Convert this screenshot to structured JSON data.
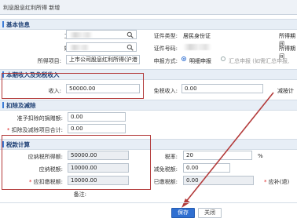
{
  "window": {
    "title": "利息股息红利所得 新增"
  },
  "basic": {
    "section_title": "基本信息",
    "employee_id_label": "工号:",
    "name_label": "姓名:",
    "id_type_label": "证件类型:",
    "id_type_value": "居民身份证",
    "id_number_label": "证件号码:",
    "item_label": "所得项目:",
    "item_value": "上市公司股息红利所得(沪港",
    "declare_label": "申报方式:",
    "declare_opt1": "明细申报",
    "declare_opt2": "汇总申报 (如需汇总申报,",
    "right_cut1": "所得期间",
    "right_cut2": "所得期间"
  },
  "income": {
    "section_title": "本期收入及免税收入",
    "income_label": "收入:",
    "income_value": "50000.00",
    "exempt_label": "免税收入:",
    "exempt_value": "0.00",
    "right_cut": "减按计"
  },
  "deduction": {
    "section_title": "扣除及减除",
    "donation_label": "准予扣除的捐赠额:",
    "donation_value": "0.00",
    "total_label": "扣除及减除项目合计:",
    "total_value": "0.00"
  },
  "tax": {
    "section_title": "税款计算",
    "taxable_label": "应纳税所得额:",
    "taxable_value": "50000.00",
    "rate_label": "税率:",
    "rate_value": "20",
    "rate_unit": "%",
    "payable_label": "应纳税额:",
    "payable_value": "10000.00",
    "reduction_label": "减免税额:",
    "reduction_value": "0.00",
    "withhold_label": "应扣缴税额:",
    "withhold_value": "10000.00",
    "paid_label": "已缴税额:",
    "paid_value": "0.00",
    "refund_cut": "应补(退)",
    "note_label": "备注:"
  },
  "footer": {
    "save_label": "保存",
    "close_label": "关闭"
  },
  "colors": {
    "accent": "#2f6fd1",
    "highlight": "#b33a3a",
    "section_bg": "#e7eef6"
  }
}
